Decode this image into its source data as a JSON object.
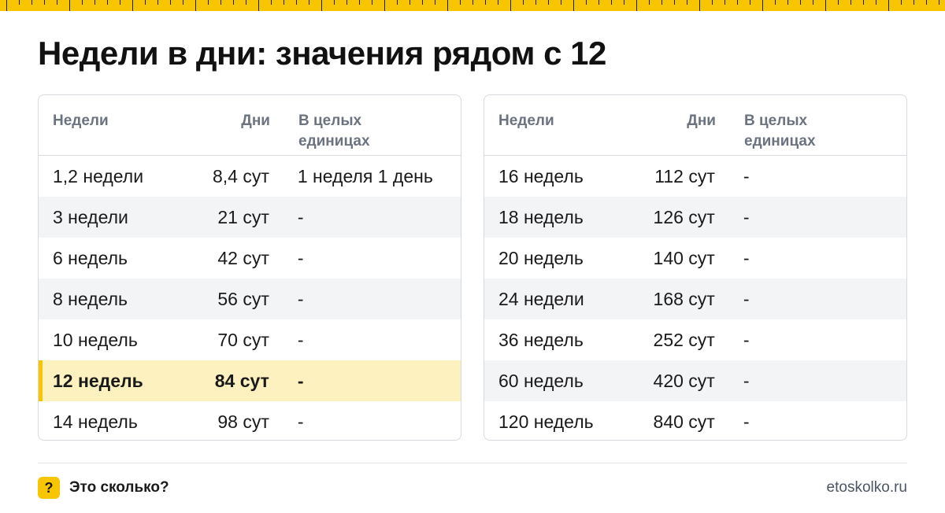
{
  "title": "Недели в дни: значения рядом с 12",
  "tables": [
    {
      "headers": {
        "weeks": "Недели",
        "days": "Дни",
        "whole": "В целых единицах"
      },
      "rows": [
        {
          "weeks": "1,2 недели",
          "days": "8,4 сут",
          "whole": "1 неделя 1 день"
        },
        {
          "weeks": "3 недели",
          "days": "21 сут",
          "whole": "-"
        },
        {
          "weeks": "6 недель",
          "days": "42 сут",
          "whole": "-"
        },
        {
          "weeks": "8 недель",
          "days": "56 сут",
          "whole": "-"
        },
        {
          "weeks": "10 недель",
          "days": "70 сут",
          "whole": "-"
        },
        {
          "weeks": "12 недель",
          "days": "84 сут",
          "whole": "-",
          "highlight": true
        },
        {
          "weeks": "14 недель",
          "days": "98 сут",
          "whole": "-"
        }
      ]
    },
    {
      "headers": {
        "weeks": "Недели",
        "days": "Дни",
        "whole": "В целых единицах"
      },
      "rows": [
        {
          "weeks": "16 недель",
          "days": "112 сут",
          "whole": "-"
        },
        {
          "weeks": "18 недель",
          "days": "126 сут",
          "whole": "-"
        },
        {
          "weeks": "20 недель",
          "days": "140 сут",
          "whole": "-"
        },
        {
          "weeks": "24 недели",
          "days": "168 сут",
          "whole": "-"
        },
        {
          "weeks": "36 недель",
          "days": "252 сут",
          "whole": "-"
        },
        {
          "weeks": "60 недель",
          "days": "420 сут",
          "whole": "-"
        },
        {
          "weeks": "120 недель",
          "days": "840 сут",
          "whole": "-"
        }
      ]
    }
  ],
  "footer": {
    "brand_icon": "?",
    "brand_name": "Это сколько?",
    "site": "etoskolko.ru"
  },
  "colors": {
    "accent": "#f7c600",
    "highlight_row": "#fdf1c0",
    "alt_row": "#f3f4f6",
    "header_text": "#6b7280"
  }
}
